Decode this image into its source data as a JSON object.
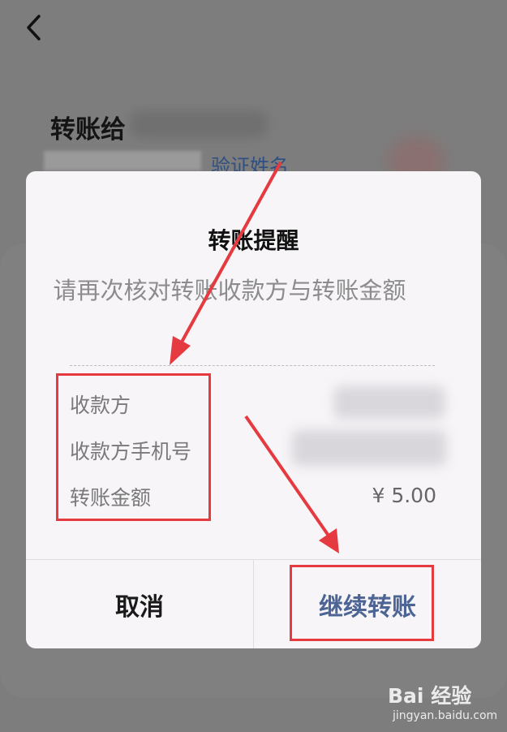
{
  "background": {
    "transfer_to_label": "转账给",
    "verify_name_link": "验证姓名"
  },
  "dialog": {
    "title": "转账提醒",
    "message": "请再次核对转账收款方与转账金额",
    "rows": [
      {
        "label": "收款方"
      },
      {
        "label": "收款方手机号"
      },
      {
        "label": "转账金额",
        "value": "¥ 5.00"
      }
    ],
    "cancel_label": "取消",
    "continue_label": "继续转账"
  },
  "watermark": {
    "logo": "Bai 经验",
    "url": "jingyan.baidu.com"
  },
  "colors": {
    "annotation_red": "#e53a3f",
    "link_blue": "#4d6594",
    "overlay_gray": "#7d7d7d"
  }
}
